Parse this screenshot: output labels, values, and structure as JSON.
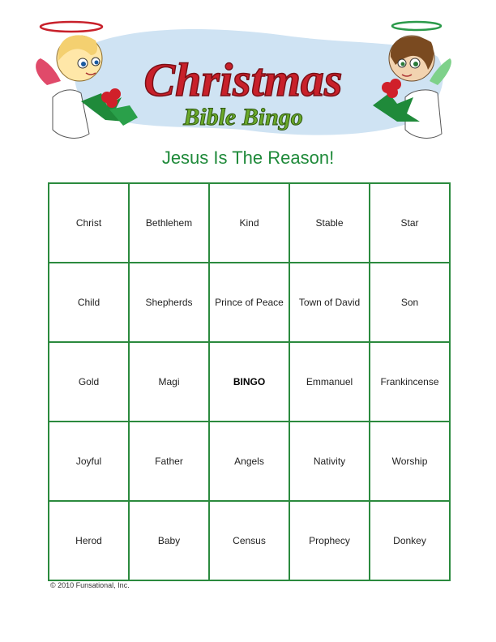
{
  "header": {
    "logo_line1": "Christmas",
    "logo_line2": "Bible Bingo"
  },
  "subtitle": "Jesus Is The Reason!",
  "bingo_grid": [
    [
      "Christ",
      "Bethlehem",
      "Kind",
      "Stable",
      "Star"
    ],
    [
      "Child",
      "Shepherds",
      "Prince of Peace",
      "Town of David",
      "Son"
    ],
    [
      "Gold",
      "Magi",
      "BINGO",
      "Emmanuel",
      "Frankincense"
    ],
    [
      "Joyful",
      "Father",
      "Angels",
      "Nativity",
      "Worship"
    ],
    [
      "Herod",
      "Baby",
      "Census",
      "Prophecy",
      "Donkey"
    ]
  ],
  "copyright": "© 2010 Funsational, Inc.",
  "colors": {
    "grid_border": "#2b8a3e",
    "title_red": "#c8202a",
    "subtitle_green": "#1f8a3a",
    "cloud_blue": "#cfe3f3"
  },
  "icons": [
    "angel-left-icon",
    "angel-right-icon",
    "holly-icon"
  ]
}
